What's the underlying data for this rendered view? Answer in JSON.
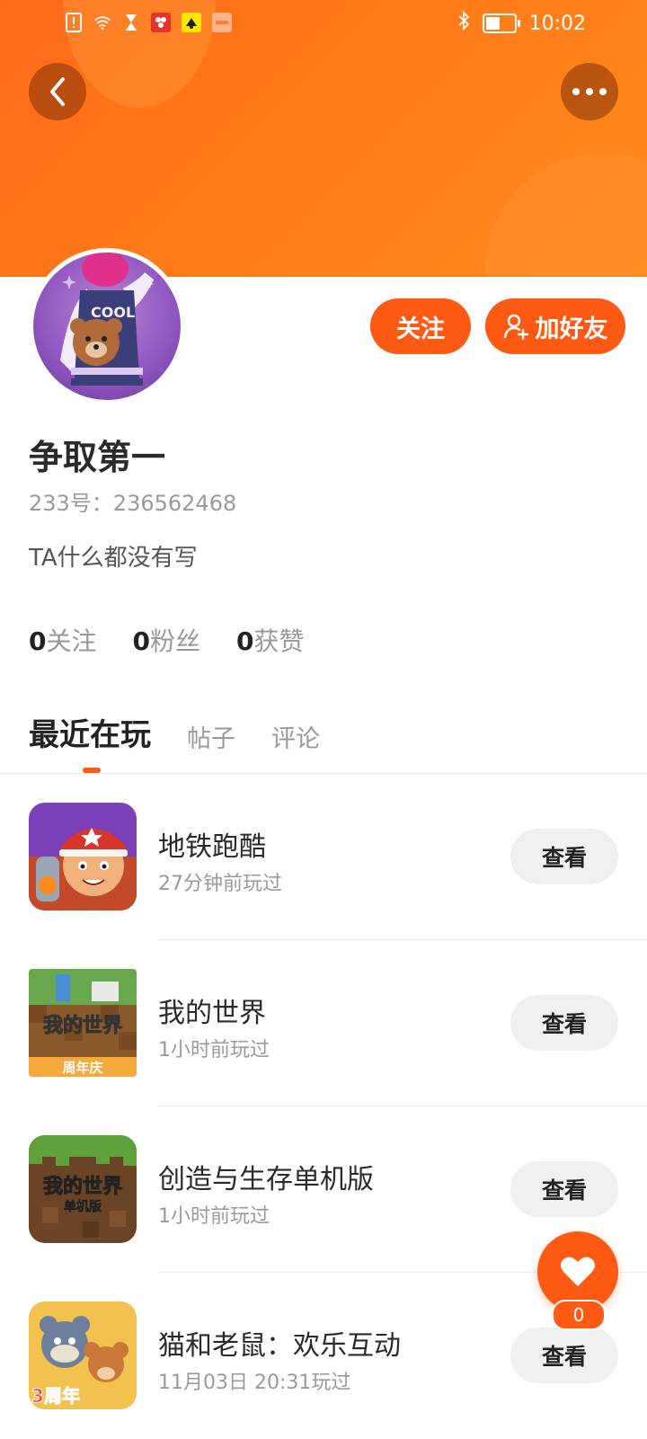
{
  "status_bar": {
    "time": "10:02",
    "left_icons": [
      "alert-icon",
      "wifi-icon",
      "hourglass-icon",
      "app-notif-icon-1",
      "app-notif-icon-2",
      "app-notif-icon-3"
    ],
    "right_icons": [
      "bluetooth-icon",
      "battery-icon"
    ]
  },
  "header": {
    "back_icon": "chevron-left-icon",
    "more_icon": "more-dots-icon",
    "banner_color": "#ff6a1a"
  },
  "profile": {
    "avatar_text": "COOL",
    "follow_label": "关注",
    "add_friend_label": "加好友",
    "username": "争取第一",
    "uid": "233号：236562468",
    "bio": "TA什么都没有写"
  },
  "stats": [
    {
      "num": "0",
      "label": "关注"
    },
    {
      "num": "0",
      "label": "粉丝"
    },
    {
      "num": "0",
      "label": "获赞"
    }
  ],
  "tabs": [
    {
      "label": "最近在玩",
      "active": true
    },
    {
      "label": "帖子",
      "active": false
    },
    {
      "label": "评论",
      "active": false
    }
  ],
  "games": [
    {
      "name": "地铁跑酷",
      "time": "27分钟前玩过",
      "action": "查看"
    },
    {
      "name": "我的世界",
      "time": "1小时前玩过",
      "action": "查看",
      "icon_text": "我的世界",
      "icon_sub": "周年庆"
    },
    {
      "name": "创造与生存单机版",
      "time": "1小时前玩过",
      "action": "查看",
      "icon_text": "我的世界",
      "icon_sub": "单机版"
    },
    {
      "name": "猫和老鼠：欢乐互动",
      "time": "11月03日 20:31玩过",
      "action": "查看",
      "icon_text": "3周年"
    }
  ],
  "like_fab": {
    "count": "0"
  },
  "colors": {
    "accent": "#ff5a14",
    "muted_text": "#9a9a9a"
  }
}
